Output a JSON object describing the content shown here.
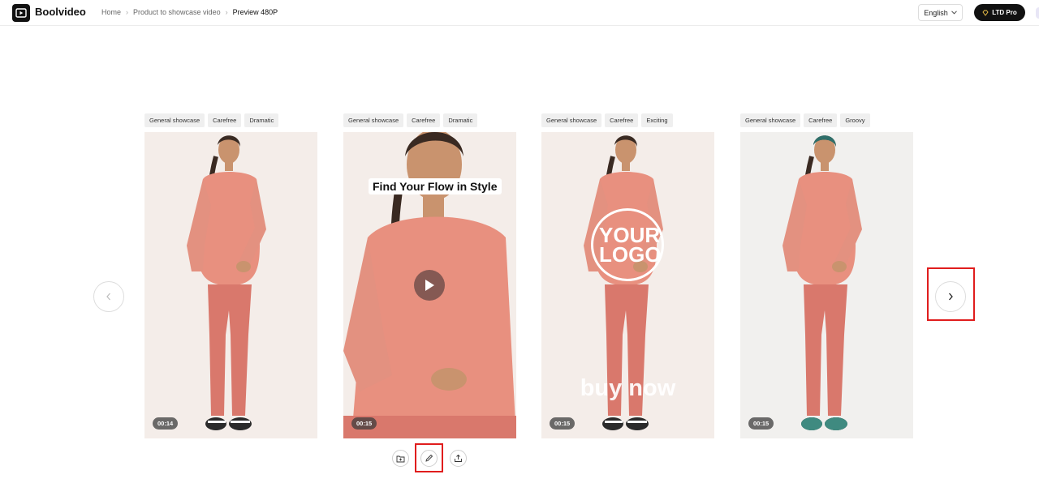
{
  "header": {
    "brand": "Boolvideo",
    "breadcrumb": [
      "Home",
      "Product to showcase video",
      "Preview 480P"
    ],
    "language": "English",
    "pro_label": "LTD Pro"
  },
  "cards": [
    {
      "tags": [
        "General showcase",
        "Carefree",
        "Dramatic"
      ],
      "duration": "00:14"
    },
    {
      "tags": [
        "General showcase",
        "Carefree",
        "Dramatic"
      ],
      "duration": "00:15",
      "overlay_title": "Find Your Flow in Style"
    },
    {
      "tags": [
        "General showcase",
        "Carefree",
        "Exciting"
      ],
      "duration": "00:15",
      "logo_text": "YOUR LOGO",
      "cta_text": "buy now"
    },
    {
      "tags": [
        "General showcase",
        "Carefree",
        "Groovy"
      ],
      "duration": "00:15"
    }
  ],
  "colors": {
    "highlight": "#e01d1d",
    "outfit": "#e8907f",
    "background": "#f4ede9"
  }
}
